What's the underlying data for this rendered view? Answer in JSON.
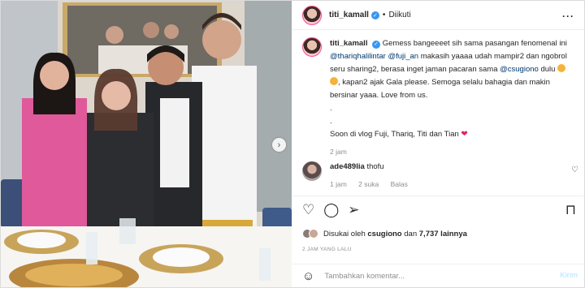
{
  "header": {
    "username": "titi_kamall",
    "follow_status": "Diikuti",
    "more_icon": "ellipsis-icon"
  },
  "caption": {
    "username": "titi_kamall",
    "text_1": "Gemess bangeeeet sih sama pasangan fenomenal ini",
    "mention_1": "@thariqhalilintar",
    "mention_2": "@fuji_an",
    "text_2": "makasih yaaaa udah mampir2 dan ngobrol seru sharing2, berasa inget jaman pacaran sama",
    "mention_3": "@csugiono",
    "text_3": "dulu",
    "text_4": ", kapan2 ajak Gala please. Semoga selalu bahagia dan makin bersinar yaaa. Love from us.",
    "dot_1": ".",
    "dot_2": ".",
    "text_5": "Soon di vlog Fuji, Thariq, Titi dan Tian",
    "time": "2 jam"
  },
  "comment": {
    "username": "ade489lia",
    "text": "thofu",
    "time": "1 jam",
    "likes": "2 suka",
    "reply": "Balas"
  },
  "actions": {
    "like_icon": "heart-icon",
    "comment_icon": "comment-icon",
    "share_icon": "send-icon",
    "save_icon": "bookmark-icon"
  },
  "likes": {
    "prefix": "Disukai oleh",
    "user": "csugiono",
    "connector": "dan",
    "count": "7,737 lainnya"
  },
  "posted_ago": "2 JAM YANG LALU",
  "add_comment": {
    "placeholder": "Tambahkan komentar...",
    "submit": "Kirim"
  },
  "colors": {
    "link": "#00376b",
    "verified": "#3897f0",
    "muted": "#8e8e8e",
    "submit_disabled": "#b2dffc"
  }
}
